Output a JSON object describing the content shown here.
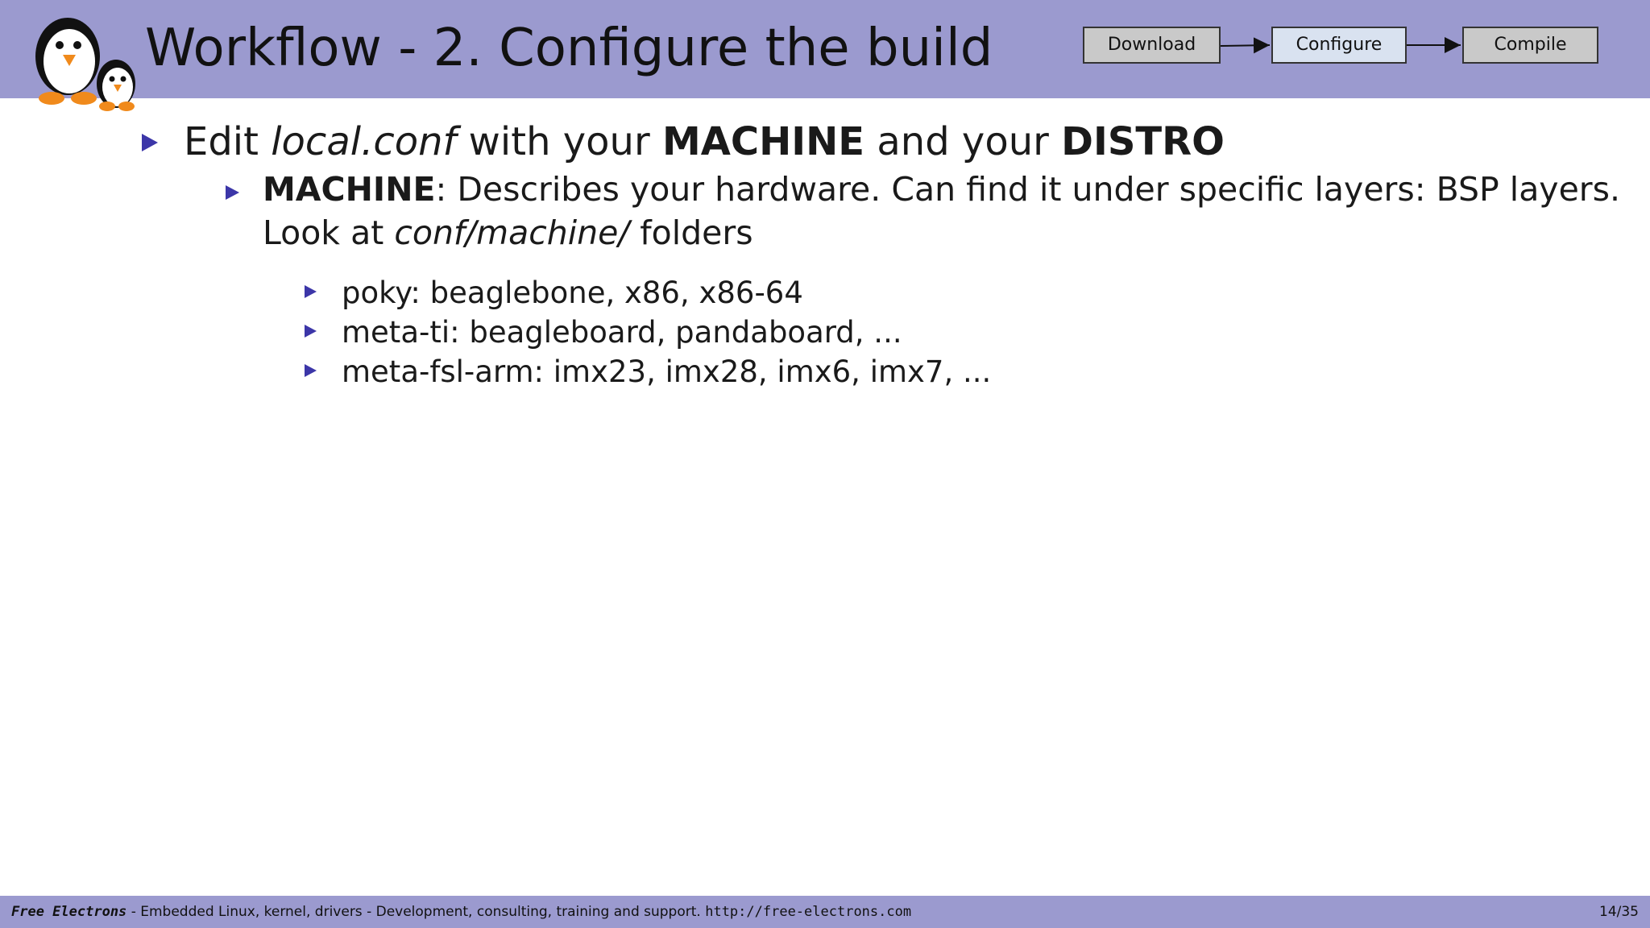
{
  "slide": {
    "title": "Workflow - 2. Configure the build",
    "page_number": "14/35"
  },
  "workflow": {
    "steps": [
      {
        "label": "Download",
        "state": "inactive"
      },
      {
        "label": "Configure",
        "state": "active"
      },
      {
        "label": "Compile",
        "state": "inactive"
      }
    ]
  },
  "content": {
    "line1": {
      "part1": "Edit ",
      "file": "local.conf",
      "part2": " with your ",
      "machine": "MACHINE",
      "part3": " and your ",
      "distro": "DISTRO"
    },
    "line2": {
      "machine": "MACHINE",
      "text1": ": Describes your hardware. Can find it under specific layers: BSP layers. Look at ",
      "folder": "conf/machine/",
      "text2": " folders"
    },
    "sub_items": [
      "poky: beaglebone, x86, x86-64",
      "meta-ti: beagleboard, pandaboard, ...",
      "meta-fsl-arm: imx23, imx28, imx6, imx7, ..."
    ]
  },
  "footer": {
    "brand": "Free Electrons",
    "tagline": " - Embedded Linux, kernel, drivers - Development, consulting, training and support.  ",
    "url": "http://free-electrons.com"
  },
  "colors": {
    "header_bg": "#9b9acf",
    "bullet": "#3c36a8",
    "active_step": "#d9e2f0",
    "inactive_step": "#c9c9c9"
  },
  "icons": [
    "penguin-logo-icon",
    "bullet-triangle-icon",
    "arrow-right-icon"
  ]
}
